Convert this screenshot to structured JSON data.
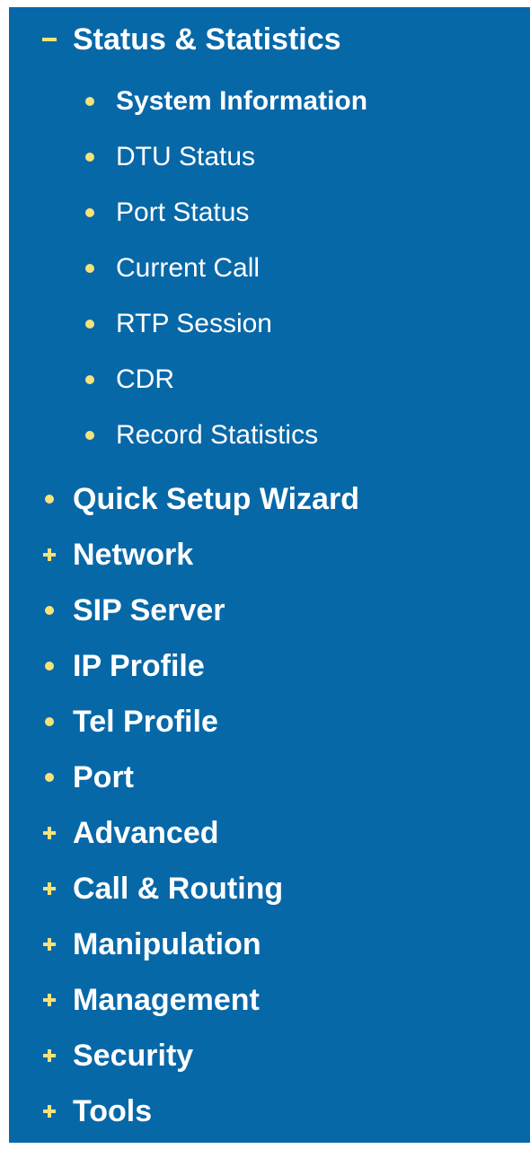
{
  "colors": {
    "panel_background": "#0768a8",
    "text": "#ffffff",
    "marker": "#f6e27a"
  },
  "menu": {
    "status_statistics": {
      "label": "Status & Statistics",
      "icon": "minus-icon",
      "expanded": true,
      "children": [
        {
          "label": "System Information",
          "active": true,
          "icon": "bullet-icon"
        },
        {
          "label": "DTU Status",
          "icon": "bullet-icon"
        },
        {
          "label": "Port Status",
          "icon": "bullet-icon"
        },
        {
          "label": "Current Call",
          "icon": "bullet-icon"
        },
        {
          "label": "RTP Session",
          "icon": "bullet-icon"
        },
        {
          "label": "CDR",
          "icon": "bullet-icon"
        },
        {
          "label": "Record Statistics",
          "icon": "bullet-icon"
        }
      ]
    },
    "items": [
      {
        "label": "Quick Setup Wizard",
        "icon": "bullet-icon"
      },
      {
        "label": "Network",
        "icon": "plus-icon"
      },
      {
        "label": "SIP Server",
        "icon": "bullet-icon"
      },
      {
        "label": "IP Profile",
        "icon": "bullet-icon"
      },
      {
        "label": "Tel Profile",
        "icon": "bullet-icon"
      },
      {
        "label": "Port",
        "icon": "bullet-icon"
      },
      {
        "label": "Advanced",
        "icon": "plus-icon"
      },
      {
        "label": "Call & Routing",
        "icon": "plus-icon"
      },
      {
        "label": "Manipulation",
        "icon": "plus-icon"
      },
      {
        "label": "Management",
        "icon": "plus-icon"
      },
      {
        "label": "Security",
        "icon": "plus-icon"
      },
      {
        "label": "Tools",
        "icon": "plus-icon"
      }
    ]
  }
}
